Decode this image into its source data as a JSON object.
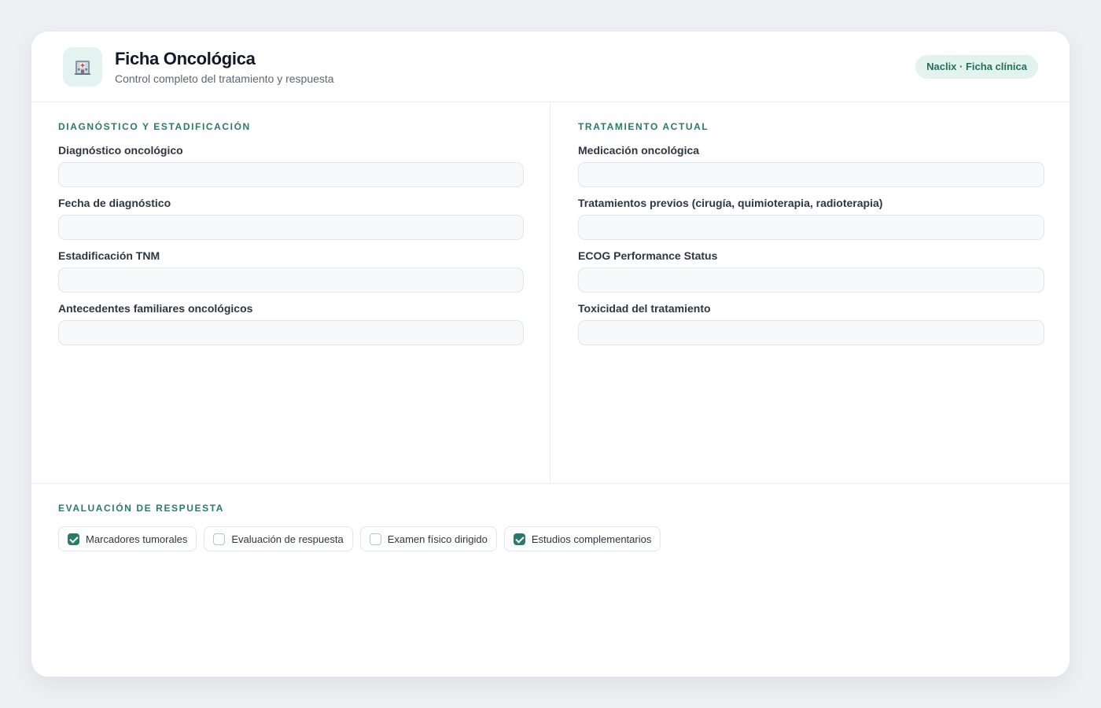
{
  "header": {
    "logo_icon": "hospital-icon",
    "title": "Ficha Oncológica",
    "subtitle": "Control completo del tratamiento y respuesta",
    "badge": "Naclix · Ficha clínica"
  },
  "colors": {
    "accent": "#2a7a6a",
    "badge_bg": "#e2f2ed",
    "page_bg": "#eef1f4"
  },
  "diagnostico": {
    "title": "Diagnóstico y estadificación",
    "fields": [
      {
        "label": "Diagnóstico oncológico",
        "value": "",
        "placeholder": ""
      },
      {
        "label": "Fecha de diagnóstico",
        "value": "",
        "placeholder": ""
      },
      {
        "label": "Estadificación TNM",
        "value": "",
        "placeholder": ""
      },
      {
        "label": "Antecedentes familiares oncológicos",
        "value": "",
        "placeholder": ""
      }
    ]
  },
  "tratamiento": {
    "title": "Tratamiento actual",
    "fields": [
      {
        "label": "Medicación oncológica",
        "value": "",
        "placeholder": ""
      },
      {
        "label": "Tratamientos previos (cirugía, quimioterapia, radioterapia)",
        "value": "",
        "placeholder": ""
      },
      {
        "label": "ECOG Performance Status",
        "value": "",
        "placeholder": ""
      },
      {
        "label": "Toxicidad del tratamiento",
        "value": "",
        "placeholder": ""
      }
    ]
  },
  "evaluacion": {
    "title": "Evaluación de respuesta",
    "checks": [
      {
        "label": "Marcadores tumorales",
        "checked": true
      },
      {
        "label": "Evaluación de respuesta",
        "checked": false
      },
      {
        "label": "Examen físico dirigido",
        "checked": false
      },
      {
        "label": "Estudios complementarios",
        "checked": true
      }
    ]
  }
}
